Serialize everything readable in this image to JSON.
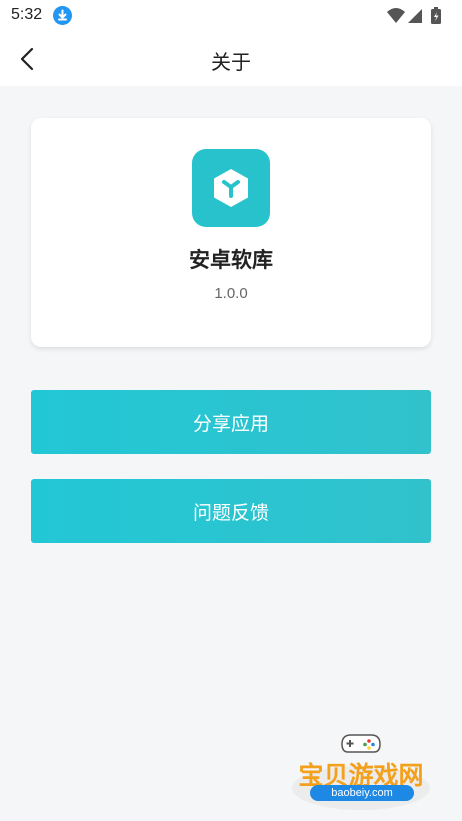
{
  "status_bar": {
    "time": "5:32",
    "icons": [
      "download-notification-icon",
      "wifi-icon",
      "signal-icon",
      "battery-icon"
    ]
  },
  "app_bar": {
    "title": "关于",
    "back_icon": "chevron-left-icon"
  },
  "app_info": {
    "name": "安卓软库",
    "version": "1.0.0",
    "icon": "cube-logo-icon",
    "icon_color": "#27c2cc"
  },
  "actions": {
    "share_label": "分享应用",
    "feedback_label": "问题反馈",
    "button_color": "#22c7d6"
  },
  "watermark": {
    "text": "宝贝游戏网",
    "url": "baobeiy.com"
  }
}
